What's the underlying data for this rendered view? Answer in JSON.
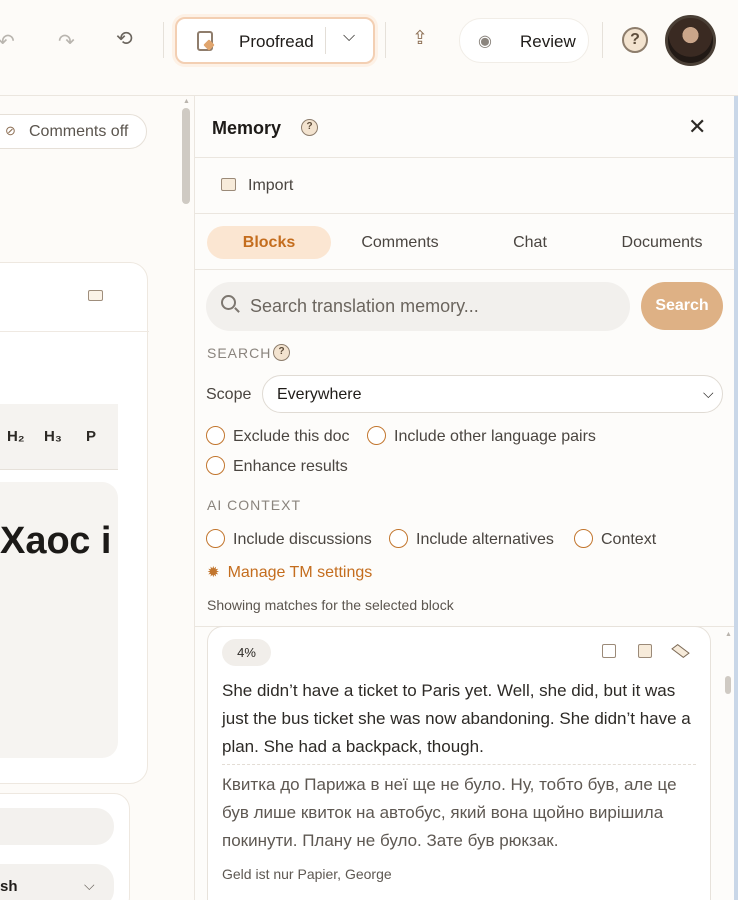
{
  "toolbar": {
    "undo_icon": "undo-icon",
    "redo_icon": "redo-icon",
    "history_icon": "history-icon",
    "proofread_label": "Proofread",
    "export_icon": "upload-icon",
    "review_label": "Review",
    "help_label": "?"
  },
  "editor": {
    "comments_toggle_label": "Comments off",
    "heading_buttons": [
      "H₂",
      "H₃",
      "P"
    ],
    "block_title_fragment": "Хаос і",
    "language_fragment": "sh"
  },
  "memory_panel": {
    "title": "Memory",
    "import_label": "Import",
    "tabs": [
      {
        "label": "Blocks",
        "active": true
      },
      {
        "label": "Comments",
        "active": false
      },
      {
        "label": "Chat",
        "active": false
      },
      {
        "label": "Documents",
        "active": false
      }
    ],
    "search": {
      "placeholder": "Search translation memory...",
      "value": "",
      "button_label": "Search"
    },
    "search_section_label": "SEARCH",
    "scope_label": "Scope",
    "scope_value": "Everywhere",
    "search_options": [
      "Exclude this doc",
      "Include other language pairs",
      "Enhance results"
    ],
    "ai_context_label": "AI CONTEXT",
    "ai_options": [
      "Include discussions",
      "Include alternatives",
      "Context"
    ],
    "manage_link": "Manage TM settings",
    "status_text": "Showing matches for the selected block",
    "results": [
      {
        "match_percent": "4%",
        "source": "She didn’t have a ticket to Paris yet. Well, she did, but it was just the bus ticket she was now abandoning. She didn’t have a plan. She had a backpack, though.",
        "target": "Квитка до Парижа в неї ще не було. Ну, тобто був, але це був лише квиток на автобус, який вона щойно вирішила покинути. Плану не було. Зате був рюкзак.",
        "document": "Geld ist nur Papier, George"
      }
    ]
  },
  "colors": {
    "accent": "#c46d1e",
    "accent_light": "#fbe6d2",
    "search_button": "#deb185"
  }
}
